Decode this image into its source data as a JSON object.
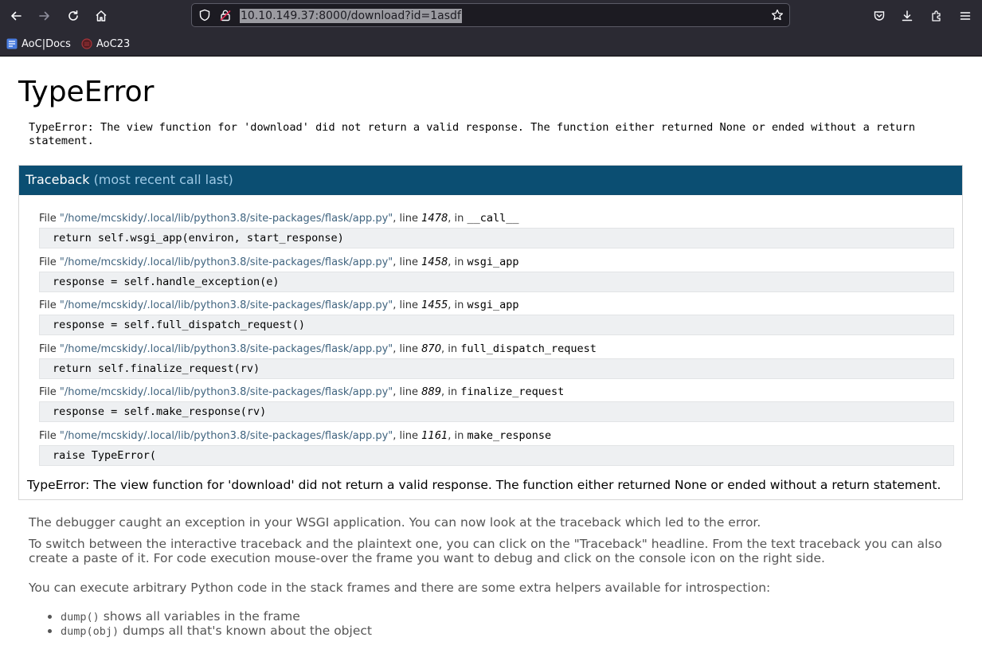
{
  "browser": {
    "url": "10.10.149.37:8000/download?id=1asdf",
    "bookmarks": [
      {
        "label": "AoC|Docs",
        "icon": "docs-icon",
        "color": "#4a7de0"
      },
      {
        "label": "AoC23",
        "icon": "aoc-icon",
        "color": "#a6353b"
      }
    ]
  },
  "page": {
    "title": "TypeError",
    "message": "TypeError: The view function for 'download' did not return a valid response. The function either returned None or ended without a return statement.",
    "traceback": {
      "heading": "Traceback",
      "heading_sub": "(most recent call last)",
      "frames": [
        {
          "file": "\"/home/mcskidy/.local/lib/python3.8/site-packages/flask/app.py\"",
          "line": "1478",
          "func": "__call__",
          "code": "return self.wsgi_app(environ, start_response)"
        },
        {
          "file": "\"/home/mcskidy/.local/lib/python3.8/site-packages/flask/app.py\"",
          "line": "1458",
          "func": "wsgi_app",
          "code": "response = self.handle_exception(e)"
        },
        {
          "file": "\"/home/mcskidy/.local/lib/python3.8/site-packages/flask/app.py\"",
          "line": "1455",
          "func": "wsgi_app",
          "code": "response = self.full_dispatch_request()"
        },
        {
          "file": "\"/home/mcskidy/.local/lib/python3.8/site-packages/flask/app.py\"",
          "line": "870",
          "func": "full_dispatch_request",
          "code": "return self.finalize_request(rv)"
        },
        {
          "file": "\"/home/mcskidy/.local/lib/python3.8/site-packages/flask/app.py\"",
          "line": "889",
          "func": "finalize_request",
          "code": "response = self.make_response(rv)"
        },
        {
          "file": "\"/home/mcskidy/.local/lib/python3.8/site-packages/flask/app.py\"",
          "line": "1161",
          "func": "make_response",
          "code": "raise TypeError("
        }
      ],
      "file_prefix": "File ",
      "line_prefix": ", line ",
      "in_prefix": ", in ",
      "footer": "TypeError: The view function for 'download' did not return a valid response. The function either returned None or ended without a return statement."
    },
    "explanation": {
      "p1": "The debugger caught an exception in your WSGI application. You can now look at the traceback which led to the error.",
      "p2": "To switch between the interactive traceback and the plaintext one, you can click on the \"Traceback\" headline. From the text traceback you can also create a paste of it. For code execution mouse-over the frame you want to debug and click on the console icon on the right side.",
      "p3": "You can execute arbitrary Python code in the stack frames and there are some extra helpers available for introspection:",
      "helpers": [
        {
          "code": "dump()",
          "text": " shows all variables in the frame"
        },
        {
          "code": "dump(obj)",
          "text": " dumps all that's known about the object"
        }
      ]
    }
  }
}
